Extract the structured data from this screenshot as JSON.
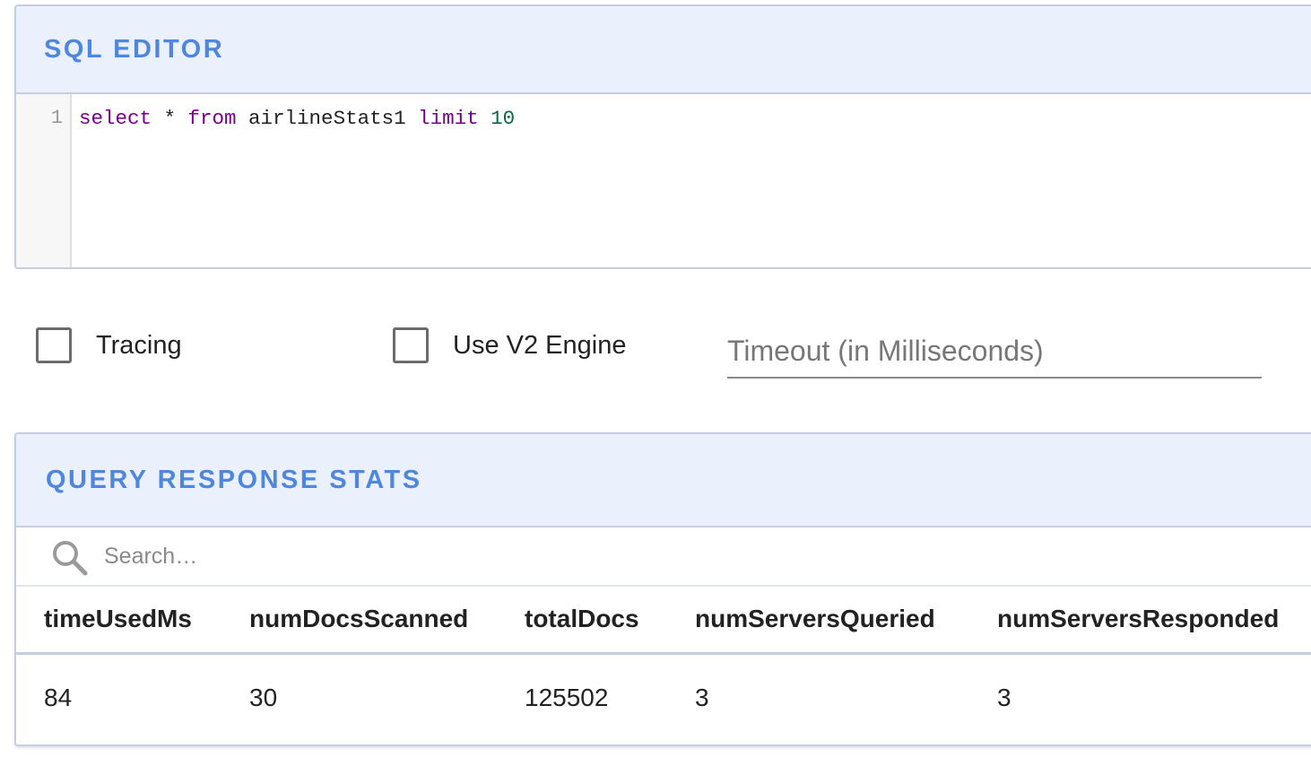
{
  "editor": {
    "title": "SQL EDITOR",
    "line_number": "1",
    "tokens": {
      "select": "select",
      "star": " * ",
      "from": "from",
      "table": " airlineStats1 ",
      "limit": "limit",
      "space": " ",
      "limit_value": "10"
    }
  },
  "options": {
    "tracing_label": "Tracing",
    "tracing_checked": false,
    "v2_label": "Use V2 Engine",
    "v2_checked": false,
    "timeout_placeholder": "Timeout (in Milliseconds)",
    "timeout_value": ""
  },
  "stats": {
    "title": "QUERY RESPONSE STATS",
    "search_placeholder": "Search…",
    "columns": [
      "timeUsedMs",
      "numDocsScanned",
      "totalDocs",
      "numServersQueried",
      "numServersResponded"
    ],
    "rows": [
      [
        "84",
        "30",
        "125502",
        "3",
        "3"
      ]
    ]
  },
  "colors": {
    "accent": "#4f86e0",
    "header_bg": "#ebf1fc",
    "border": "#c3cfe0",
    "keyword": "#770088",
    "number": "#116644"
  }
}
